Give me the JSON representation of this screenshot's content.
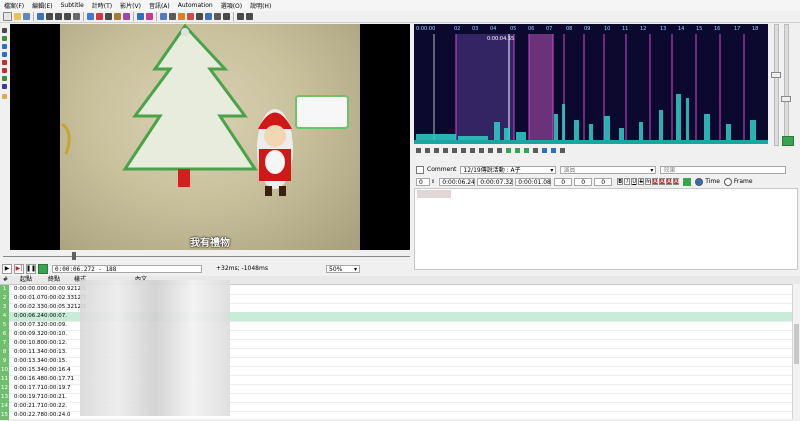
{
  "menu": [
    "檔案(F)",
    "編輯(E)",
    "Subtitle",
    "計時(T)",
    "影片(V)",
    "音訊(A)",
    "Automation",
    "選項(O)",
    "說明(H)"
  ],
  "video": {
    "subtitle": "我有禮物",
    "zoom": "50%"
  },
  "controls": {
    "play": "▶",
    "play_sel": "▶|",
    "pause": "❚❚",
    "time": "0:00:06.272 - 188",
    "offset": "+32ms; -1048ms",
    "zoom": "50%"
  },
  "waveform": {
    "time_labels": [
      "0:00:00",
      "02",
      "03",
      "04",
      "05",
      "06",
      "07",
      "08",
      "09",
      "10",
      "11",
      "12",
      "13",
      "14",
      "15",
      "16",
      "17",
      "18"
    ],
    "current_time": "0:00:04.55"
  },
  "edit": {
    "comment_label": "Comment",
    "style": "12/19傳說活動 : A子",
    "actor_placeholder": "演員",
    "effect_placeholder": "效果",
    "layer": "0",
    "start": "0:00:06.24",
    "end": "0:00:07.32",
    "duration": "0:00:01.08",
    "margin_l": "0",
    "margin_r": "0",
    "margin_v": "0",
    "fmt_buttons": [
      "B",
      "I",
      "U",
      "S",
      "fn",
      "AB",
      "AB",
      "AB",
      "AB"
    ],
    "time_label": "Time",
    "frame_label": "Frame"
  },
  "grid": {
    "headers": [
      "#",
      "起點",
      "終點",
      "樣式",
      "",
      "內文"
    ],
    "rows": [
      {
        "n": "1",
        "start": "0:00:00.00",
        "end": "0:00:00.92",
        "style": "12/1"
      },
      {
        "n": "2",
        "start": "0:00:01.07",
        "end": "0:00:02.33",
        "style": "12/1"
      },
      {
        "n": "3",
        "start": "0:00:02.33",
        "end": "0:00:05.32",
        "style": "12/1"
      },
      {
        "n": "4",
        "start": "0:00:06.24",
        "end": "0:00:07.",
        "style": ""
      },
      {
        "n": "5",
        "start": "0:00:07.32",
        "end": "0:00:09.",
        "style": ""
      },
      {
        "n": "6",
        "start": "0:00:09.32",
        "end": "0:00:10.",
        "style": ""
      },
      {
        "n": "7",
        "start": "0:00:10.80",
        "end": "0:00:12.",
        "style": ""
      },
      {
        "n": "8",
        "start": "0:00:11.34",
        "end": "0:00:13.",
        "style": ""
      },
      {
        "n": "9",
        "start": "0:00:13.34",
        "end": "0:00:15.",
        "style": ""
      },
      {
        "n": "10",
        "start": "0:00:15.34",
        "end": "0:00:16.4",
        "style": ""
      },
      {
        "n": "11",
        "start": "0:00:16.48",
        "end": "0:00:17.71",
        "style": ""
      },
      {
        "n": "12",
        "start": "0:00:17.71",
        "end": "0:00:19.7",
        "style": ""
      },
      {
        "n": "13",
        "start": "0:00:19.71",
        "end": "0:00:21.",
        "style": ""
      },
      {
        "n": "14",
        "start": "0:00:21.71",
        "end": "0:00:22.",
        "style": ""
      },
      {
        "n": "15",
        "start": "0:00:22.78",
        "end": "0:00:24.0",
        "style": ""
      }
    ]
  },
  "colors": {
    "selected_row": "#c8ecd8",
    "row_number": "#6fbf6f",
    "wave_bg": "#0b0a2e",
    "wave_accent": "#d046c9"
  }
}
